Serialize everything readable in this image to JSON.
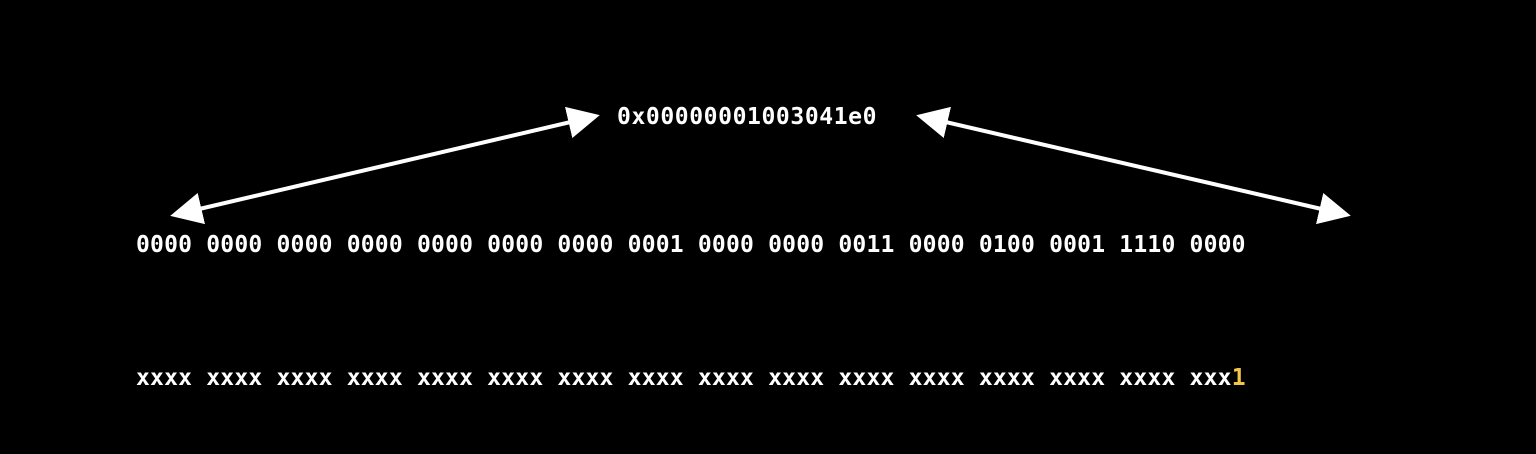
{
  "pointer": {
    "hex_address": "0x00000001003041e0"
  },
  "binary_row": {
    "text": "0000 0000 0000 0000 0000 0000 0000 0001 0000 0000 0011 0000 0100 0001 1110 0000"
  },
  "mask_row": {
    "prefix": "xxxx xxxx xxxx xxxx xxxx xxxx xxxx xxxx xxxx xxxx xxxx xxxx xxxx xxxx xxxx xxx",
    "highlight_bit": "1"
  },
  "colors": {
    "background": "#000000",
    "text": "#ffffff",
    "highlight": "#f3c64a"
  }
}
